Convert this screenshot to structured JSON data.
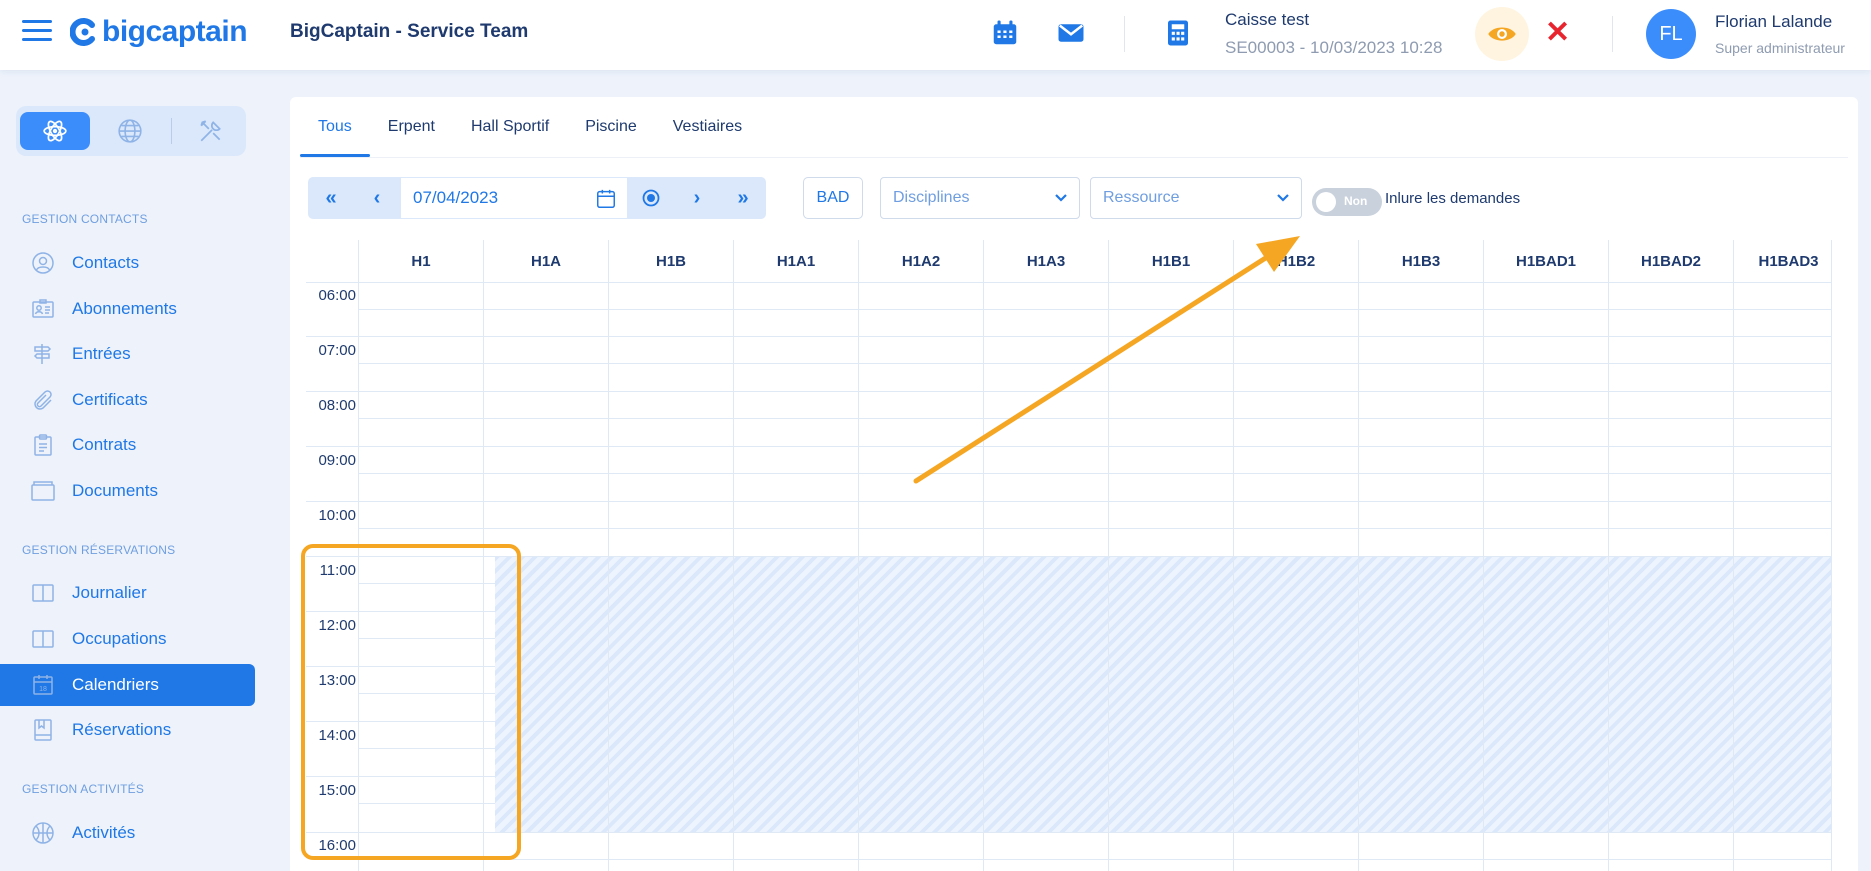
{
  "header": {
    "logo_text": "bigcaptain",
    "team": "BigCaptain - Service Team",
    "caisse_title": "Caisse test",
    "caisse_detail": "SE00003 - 10/03/2023 10:28",
    "user_initials": "FL",
    "user_name": "Florian Lalande",
    "user_role": "Super administrateur",
    "accent": "#1f78e6",
    "close_color": "#e8242f",
    "eye_color": "#f5a623"
  },
  "sidebar": {
    "sections": [
      {
        "title": "GESTION CONTACTS"
      },
      {
        "title": "GESTION RÉSERVATIONS"
      },
      {
        "title": "GESTION ACTIVITÉS"
      }
    ],
    "items": [
      {
        "label": "Contacts",
        "icon": "user-circle-icon"
      },
      {
        "label": "Abonnements",
        "icon": "id-card-icon"
      },
      {
        "label": "Entrées",
        "icon": "signpost-icon"
      },
      {
        "label": "Certificats",
        "icon": "paperclip-icon"
      },
      {
        "label": "Contrats",
        "icon": "clipboard-icon"
      },
      {
        "label": "Documents",
        "icon": "folder-icon"
      },
      {
        "label": "Journalier",
        "icon": "book-open-icon"
      },
      {
        "label": "Occupations",
        "icon": "book-open-icon"
      },
      {
        "label": "Calendriers",
        "icon": "calendar-icon",
        "active": true
      },
      {
        "label": "Réservations",
        "icon": "bookmark-book-icon"
      },
      {
        "label": "Activités",
        "icon": "basketball-icon"
      }
    ]
  },
  "tabs": [
    "Tous",
    "Erpent",
    "Hall Sportif",
    "Piscine",
    "Vestiaires"
  ],
  "active_tab": "Tous",
  "toolbar": {
    "date": "07/04/2023",
    "bad_label": "BAD",
    "disciplines_placeholder": "Disciplines",
    "ressource_placeholder": "Ressource",
    "toggle_state": "Non",
    "toggle_label": "Inlure les demandes"
  },
  "calendar": {
    "columns": [
      "H1",
      "H1A",
      "H1B",
      "H1A1",
      "H1A2",
      "H1A3",
      "H1B1",
      "H1B2",
      "H1B3",
      "H1BAD1",
      "H1BAD2",
      "H1BAD3"
    ],
    "times": [
      "06:00",
      "07:00",
      "08:00",
      "09:00",
      "10:00",
      "11:00",
      "12:00",
      "13:00",
      "14:00",
      "15:00",
      "16:00"
    ],
    "blocked_range": "11:00 - 16:00",
    "grid_color": "#dfe9f6",
    "hatch_color": "#dbe8fb"
  },
  "annotation": {
    "color": "#f5a623"
  }
}
